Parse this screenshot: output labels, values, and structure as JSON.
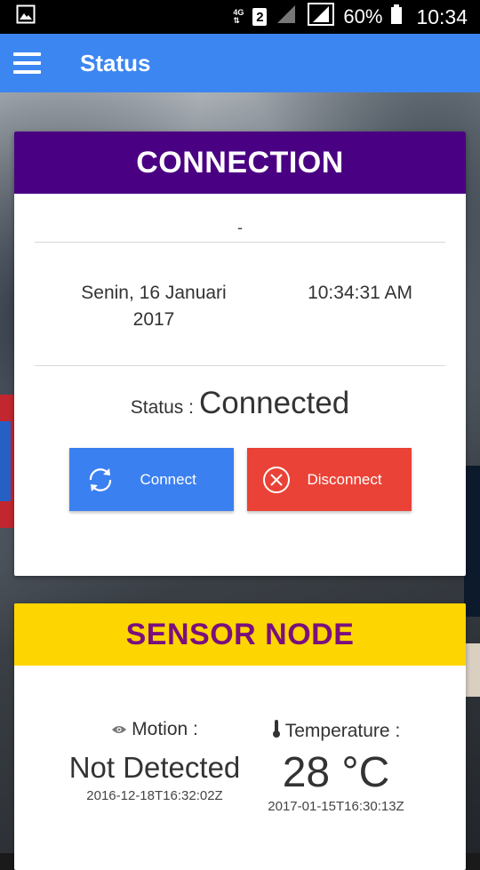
{
  "statusbar": {
    "network": "4G",
    "sim": "2",
    "battery": "60%",
    "time": "10:34"
  },
  "appbar": {
    "title": "Status"
  },
  "connection": {
    "header": "CONNECTION",
    "dash": "-",
    "date": "Senin, 16 Januari 2017",
    "time": "10:34:31 AM",
    "status_label": "Status :",
    "status_value": "Connected",
    "connect_label": "Connect",
    "disconnect_label": "Disconnect"
  },
  "sensor": {
    "header": "SENSOR NODE",
    "motion_label": "Motion :",
    "motion_value": "Not Detected",
    "motion_time": "2016-12-18T16:32:02Z",
    "temperature_label": "Temperature :",
    "temperature_value": "28 °C",
    "temperature_time": "2017-01-15T16:30:13Z"
  },
  "colors": {
    "appbar": "#3b86f1",
    "connection_header": "#4a0082",
    "sensor_header": "#fdd500",
    "sensor_header_text": "#7a0f7d",
    "connect_button": "#3b80f1",
    "disconnect_button": "#ea4236"
  },
  "icons": {
    "gallery": "image-icon",
    "signal": "signal-icon",
    "battery": "battery-icon",
    "menu": "hamburger-icon",
    "connect": "refresh-icon",
    "disconnect": "close-circle-icon",
    "motion": "eye-icon",
    "temperature": "thermometer-icon"
  }
}
